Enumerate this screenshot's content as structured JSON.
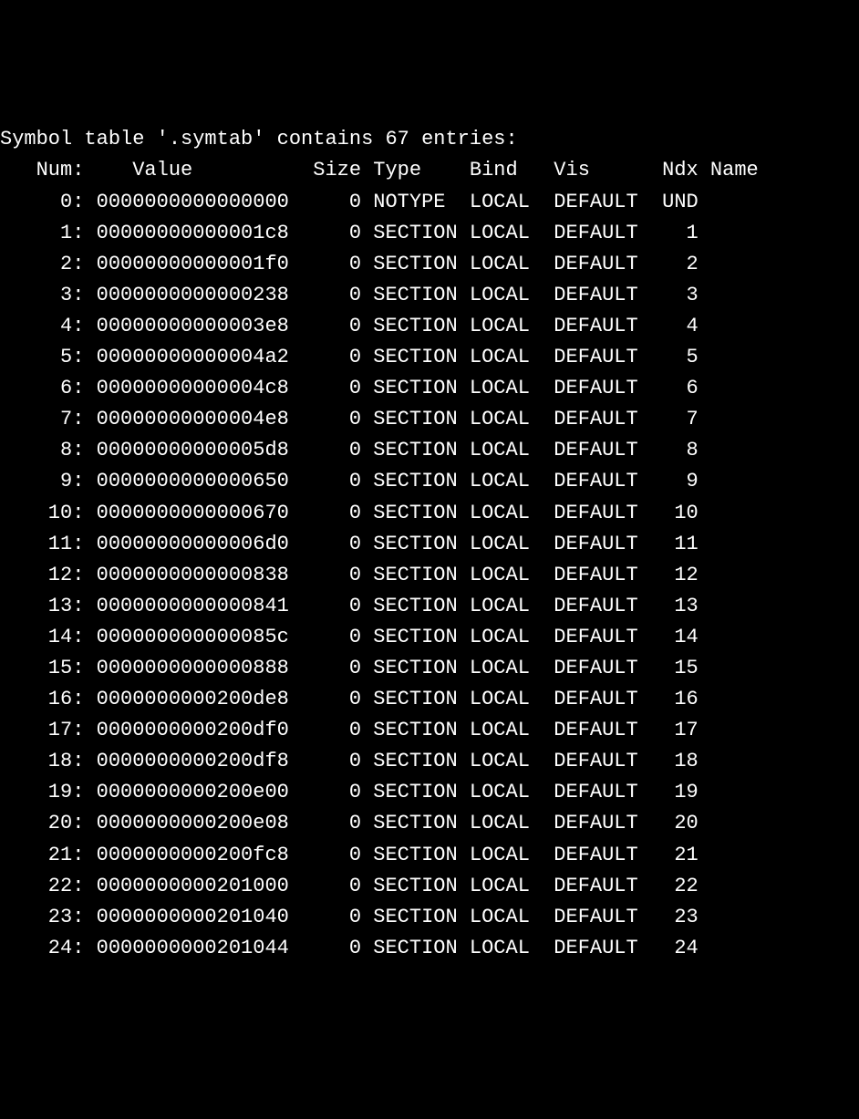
{
  "title_line": "Symbol table '.symtab' contains 67 entries:",
  "header": {
    "num": "Num:",
    "value": "Value",
    "size": "Size",
    "type": "Type",
    "bind": "Bind",
    "vis": "Vis",
    "ndx": "Ndx",
    "name": "Name"
  },
  "rows": [
    {
      "num": "0:",
      "value": "0000000000000000",
      "size": "0",
      "type": "NOTYPE",
      "bind": "LOCAL",
      "vis": "DEFAULT",
      "ndx": "UND",
      "name": ""
    },
    {
      "num": "1:",
      "value": "00000000000001c8",
      "size": "0",
      "type": "SECTION",
      "bind": "LOCAL",
      "vis": "DEFAULT",
      "ndx": "1",
      "name": ""
    },
    {
      "num": "2:",
      "value": "00000000000001f0",
      "size": "0",
      "type": "SECTION",
      "bind": "LOCAL",
      "vis": "DEFAULT",
      "ndx": "2",
      "name": ""
    },
    {
      "num": "3:",
      "value": "0000000000000238",
      "size": "0",
      "type": "SECTION",
      "bind": "LOCAL",
      "vis": "DEFAULT",
      "ndx": "3",
      "name": ""
    },
    {
      "num": "4:",
      "value": "00000000000003e8",
      "size": "0",
      "type": "SECTION",
      "bind": "LOCAL",
      "vis": "DEFAULT",
      "ndx": "4",
      "name": ""
    },
    {
      "num": "5:",
      "value": "00000000000004a2",
      "size": "0",
      "type": "SECTION",
      "bind": "LOCAL",
      "vis": "DEFAULT",
      "ndx": "5",
      "name": ""
    },
    {
      "num": "6:",
      "value": "00000000000004c8",
      "size": "0",
      "type": "SECTION",
      "bind": "LOCAL",
      "vis": "DEFAULT",
      "ndx": "6",
      "name": ""
    },
    {
      "num": "7:",
      "value": "00000000000004e8",
      "size": "0",
      "type": "SECTION",
      "bind": "LOCAL",
      "vis": "DEFAULT",
      "ndx": "7",
      "name": ""
    },
    {
      "num": "8:",
      "value": "00000000000005d8",
      "size": "0",
      "type": "SECTION",
      "bind": "LOCAL",
      "vis": "DEFAULT",
      "ndx": "8",
      "name": ""
    },
    {
      "num": "9:",
      "value": "0000000000000650",
      "size": "0",
      "type": "SECTION",
      "bind": "LOCAL",
      "vis": "DEFAULT",
      "ndx": "9",
      "name": ""
    },
    {
      "num": "10:",
      "value": "0000000000000670",
      "size": "0",
      "type": "SECTION",
      "bind": "LOCAL",
      "vis": "DEFAULT",
      "ndx": "10",
      "name": ""
    },
    {
      "num": "11:",
      "value": "00000000000006d0",
      "size": "0",
      "type": "SECTION",
      "bind": "LOCAL",
      "vis": "DEFAULT",
      "ndx": "11",
      "name": ""
    },
    {
      "num": "12:",
      "value": "0000000000000838",
      "size": "0",
      "type": "SECTION",
      "bind": "LOCAL",
      "vis": "DEFAULT",
      "ndx": "12",
      "name": ""
    },
    {
      "num": "13:",
      "value": "0000000000000841",
      "size": "0",
      "type": "SECTION",
      "bind": "LOCAL",
      "vis": "DEFAULT",
      "ndx": "13",
      "name": ""
    },
    {
      "num": "14:",
      "value": "000000000000085c",
      "size": "0",
      "type": "SECTION",
      "bind": "LOCAL",
      "vis": "DEFAULT",
      "ndx": "14",
      "name": ""
    },
    {
      "num": "15:",
      "value": "0000000000000888",
      "size": "0",
      "type": "SECTION",
      "bind": "LOCAL",
      "vis": "DEFAULT",
      "ndx": "15",
      "name": ""
    },
    {
      "num": "16:",
      "value": "0000000000200de8",
      "size": "0",
      "type": "SECTION",
      "bind": "LOCAL",
      "vis": "DEFAULT",
      "ndx": "16",
      "name": ""
    },
    {
      "num": "17:",
      "value": "0000000000200df0",
      "size": "0",
      "type": "SECTION",
      "bind": "LOCAL",
      "vis": "DEFAULT",
      "ndx": "17",
      "name": ""
    },
    {
      "num": "18:",
      "value": "0000000000200df8",
      "size": "0",
      "type": "SECTION",
      "bind": "LOCAL",
      "vis": "DEFAULT",
      "ndx": "18",
      "name": ""
    },
    {
      "num": "19:",
      "value": "0000000000200e00",
      "size": "0",
      "type": "SECTION",
      "bind": "LOCAL",
      "vis": "DEFAULT",
      "ndx": "19",
      "name": ""
    },
    {
      "num": "20:",
      "value": "0000000000200e08",
      "size": "0",
      "type": "SECTION",
      "bind": "LOCAL",
      "vis": "DEFAULT",
      "ndx": "20",
      "name": ""
    },
    {
      "num": "21:",
      "value": "0000000000200fc8",
      "size": "0",
      "type": "SECTION",
      "bind": "LOCAL",
      "vis": "DEFAULT",
      "ndx": "21",
      "name": ""
    },
    {
      "num": "22:",
      "value": "0000000000201000",
      "size": "0",
      "type": "SECTION",
      "bind": "LOCAL",
      "vis": "DEFAULT",
      "ndx": "22",
      "name": ""
    },
    {
      "num": "23:",
      "value": "0000000000201040",
      "size": "0",
      "type": "SECTION",
      "bind": "LOCAL",
      "vis": "DEFAULT",
      "ndx": "23",
      "name": ""
    },
    {
      "num": "24:",
      "value": "0000000000201044",
      "size": "0",
      "type": "SECTION",
      "bind": "LOCAL",
      "vis": "DEFAULT",
      "ndx": "24",
      "name": ""
    }
  ]
}
